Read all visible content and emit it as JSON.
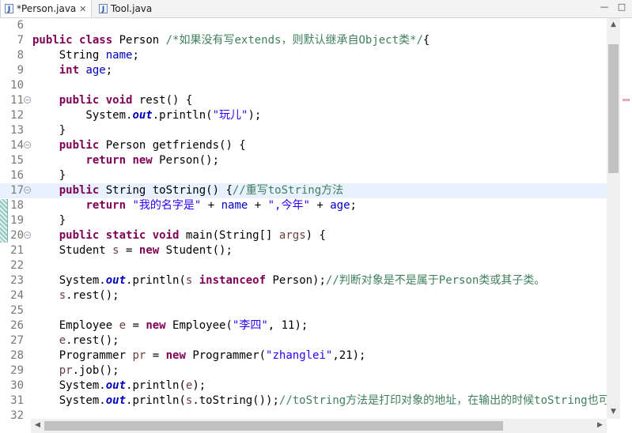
{
  "tabs": [
    {
      "label": "*Person.java",
      "icon": "java-file-icon",
      "active": true,
      "close": "✕"
    },
    {
      "label": "Tool.java",
      "icon": "java-file-icon",
      "active": false
    }
  ],
  "icon_glyph": "J",
  "window_buttons": {
    "minimize": "—",
    "maximize": "□"
  },
  "editor": {
    "current_line": 17,
    "lines": [
      {
        "n": "6"
      },
      {
        "n": "7",
        "parts": [
          [
            "kw",
            "public"
          ],
          [
            "",
            " "
          ],
          [
            "kw",
            "class"
          ],
          [
            "",
            " Person "
          ],
          [
            "cmt",
            "/*如果没有写extends，则默认继承自Object类*/"
          ],
          [
            "",
            "{"
          ]
        ]
      },
      {
        "n": "8",
        "parts": [
          [
            "",
            "    String "
          ],
          [
            "fld",
            "name"
          ],
          [
            "",
            ";"
          ]
        ]
      },
      {
        "n": "9",
        "parts": [
          [
            "",
            "    "
          ],
          [
            "kw",
            "int"
          ],
          [
            "",
            " "
          ],
          [
            "fld",
            "age"
          ],
          [
            "",
            ";"
          ]
        ]
      },
      {
        "n": "10"
      },
      {
        "n": "11",
        "fold": true,
        "parts": [
          [
            "",
            "    "
          ],
          [
            "kw",
            "public"
          ],
          [
            "",
            " "
          ],
          [
            "kw",
            "void"
          ],
          [
            "",
            " rest() {"
          ]
        ]
      },
      {
        "n": "12",
        "parts": [
          [
            "",
            "        System."
          ],
          [
            "sfld",
            "out"
          ],
          [
            "",
            ".println("
          ],
          [
            "str",
            "\"玩儿\""
          ],
          [
            "",
            ");"
          ]
        ]
      },
      {
        "n": "13",
        "parts": [
          [
            "",
            "    }"
          ]
        ]
      },
      {
        "n": "14",
        "fold": true,
        "parts": [
          [
            "",
            "    "
          ],
          [
            "kw",
            "public"
          ],
          [
            "",
            " Person getfriends() {"
          ]
        ]
      },
      {
        "n": "15",
        "parts": [
          [
            "",
            "        "
          ],
          [
            "kw",
            "return"
          ],
          [
            "",
            " "
          ],
          [
            "kw",
            "new"
          ],
          [
            "",
            " Person();"
          ]
        ]
      },
      {
        "n": "16",
        "parts": [
          [
            "",
            "    }"
          ]
        ]
      },
      {
        "n": "17",
        "fold": true,
        "parts": [
          [
            "",
            "    "
          ],
          [
            "kw",
            "public"
          ],
          [
            "",
            " String toString() {"
          ],
          [
            "cmt",
            "//重写toString方法"
          ]
        ]
      },
      {
        "n": "18",
        "parts": [
          [
            "",
            "        "
          ],
          [
            "kw",
            "return"
          ],
          [
            "",
            " "
          ],
          [
            "str",
            "\"我的名字是\""
          ],
          [
            "",
            " + "
          ],
          [
            "fld",
            "name"
          ],
          [
            "",
            " + "
          ],
          [
            "str",
            "\",今年\""
          ],
          [
            "",
            " + "
          ],
          [
            "fld",
            "age"
          ],
          [
            "",
            ";"
          ]
        ]
      },
      {
        "n": "19",
        "parts": [
          [
            "",
            "    }"
          ]
        ]
      },
      {
        "n": "20",
        "fold": true,
        "parts": [
          [
            "",
            "    "
          ],
          [
            "kw",
            "public"
          ],
          [
            "",
            " "
          ],
          [
            "kw",
            "static"
          ],
          [
            "",
            " "
          ],
          [
            "kw",
            "void"
          ],
          [
            "",
            " main(String[] "
          ],
          [
            "prm",
            "args"
          ],
          [
            "",
            ") {"
          ]
        ]
      },
      {
        "n": "21",
        "parts": [
          [
            "",
            "    Student "
          ],
          [
            "prm",
            "s"
          ],
          [
            "",
            " = "
          ],
          [
            "kw",
            "new"
          ],
          [
            "",
            " Student();"
          ]
        ]
      },
      {
        "n": "22"
      },
      {
        "n": "23",
        "parts": [
          [
            "",
            "    System."
          ],
          [
            "sfld",
            "out"
          ],
          [
            "",
            ".println("
          ],
          [
            "prm",
            "s"
          ],
          [
            "",
            " "
          ],
          [
            "kw",
            "instanceof"
          ],
          [
            "",
            " Person);"
          ],
          [
            "cmt",
            "//判断对象是不是属于Person类或其子类。"
          ]
        ]
      },
      {
        "n": "24",
        "parts": [
          [
            "",
            "    "
          ],
          [
            "prm",
            "s"
          ],
          [
            "",
            ".rest();"
          ]
        ]
      },
      {
        "n": "25"
      },
      {
        "n": "26",
        "parts": [
          [
            "",
            "    Employee "
          ],
          [
            "prm",
            "e"
          ],
          [
            "",
            " = "
          ],
          [
            "kw",
            "new"
          ],
          [
            "",
            " Employee("
          ],
          [
            "str",
            "\"李四\""
          ],
          [
            "",
            ", 11);"
          ]
        ]
      },
      {
        "n": "27",
        "parts": [
          [
            "",
            "    "
          ],
          [
            "prm",
            "e"
          ],
          [
            "",
            ".rest();"
          ]
        ]
      },
      {
        "n": "28",
        "parts": [
          [
            "",
            "    Programmer "
          ],
          [
            "prm",
            "pr"
          ],
          [
            "",
            " = "
          ],
          [
            "kw",
            "new"
          ],
          [
            "",
            " Programmer("
          ],
          [
            "str",
            "\"zhanglei\""
          ],
          [
            "",
            ",21);"
          ]
        ]
      },
      {
        "n": "29",
        "parts": [
          [
            "",
            "    "
          ],
          [
            "prm",
            "pr"
          ],
          [
            "",
            ".job();"
          ]
        ]
      },
      {
        "n": "30",
        "parts": [
          [
            "",
            "    System."
          ],
          [
            "sfld",
            "out"
          ],
          [
            "",
            ".println("
          ],
          [
            "prm",
            "e"
          ],
          [
            "",
            ");"
          ]
        ]
      },
      {
        "n": "31",
        "parts": [
          [
            "",
            "    System."
          ],
          [
            "sfld",
            "out"
          ],
          [
            "",
            ".println("
          ],
          [
            "prm",
            "s"
          ],
          [
            "",
            ".toString());"
          ],
          [
            "cmt",
            "//toString方法是打印对象的地址，在输出的时候toString也可"
          ]
        ]
      },
      {
        "n": "32"
      }
    ]
  },
  "scrollbars": {
    "up": "▲",
    "down": "▼",
    "left": "◀",
    "right": "▶"
  }
}
